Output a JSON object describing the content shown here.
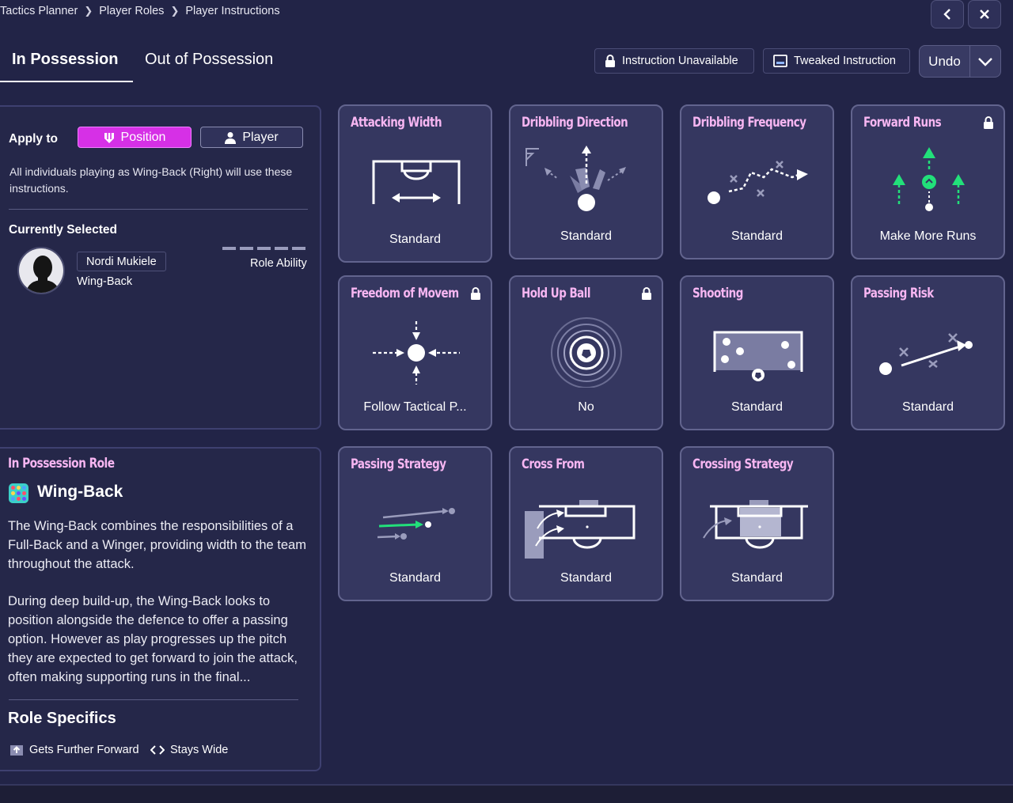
{
  "breadcrumbs": [
    "Tactics Planner",
    "Player Roles",
    "Player Instructions"
  ],
  "tabs": [
    "In Possession",
    "Out of Possession"
  ],
  "legend": {
    "unavailable": "Instruction Unavailable",
    "tweaked": "Tweaked Instruction"
  },
  "undo_label": "Undo",
  "apply": {
    "label": "Apply to",
    "position": "Position",
    "player": "Player",
    "description": "All individuals playing as Wing-Back (Right) will use these instructions."
  },
  "current": {
    "label": "Currently Selected",
    "name": "Nordi Mukiele",
    "role": "Wing-Back",
    "role_ability_label": "Role Ability"
  },
  "role_panel": {
    "title": "In Possession Role",
    "role_name": "Wing-Back",
    "para1": "The Wing-Back combines the responsibilities of a Full-Back and a Winger, providing width to the team throughout the attack.",
    "para2": "During deep build-up, the Wing-Back looks to position alongside the defence to offer a passing option. However as play progresses up the pitch they are expected to get forward to join the attack, often making supporting runs in the final...",
    "specifics_title": "Role Specifics",
    "specifics": [
      "Gets Further Forward",
      "Stays Wide"
    ]
  },
  "instructions": [
    {
      "title": "Attacking Width",
      "value": "Standard",
      "locked": false
    },
    {
      "title": "Dribbling Direction",
      "value": "Standard",
      "locked": false
    },
    {
      "title": "Dribbling Frequency",
      "value": "Standard",
      "locked": false
    },
    {
      "title": "Forward Runs",
      "value": "Make More Runs",
      "locked": true
    },
    {
      "title": "Freedom of Movement",
      "value": "Follow Tactical P...",
      "locked": true
    },
    {
      "title": "Hold Up Ball",
      "value": "No",
      "locked": true
    },
    {
      "title": "Shooting",
      "value": "Standard",
      "locked": false
    },
    {
      "title": "Passing Risk",
      "value": "Standard",
      "locked": false
    },
    {
      "title": "Passing Strategy",
      "value": "Standard",
      "locked": false
    },
    {
      "title": "Cross From",
      "value": "Standard",
      "locked": false
    },
    {
      "title": "Crossing Strategy",
      "value": "Standard",
      "locked": false
    }
  ],
  "colors": {
    "accent": "#d630e6",
    "title_pink": "#f7b6f2",
    "green": "#22e07a"
  }
}
